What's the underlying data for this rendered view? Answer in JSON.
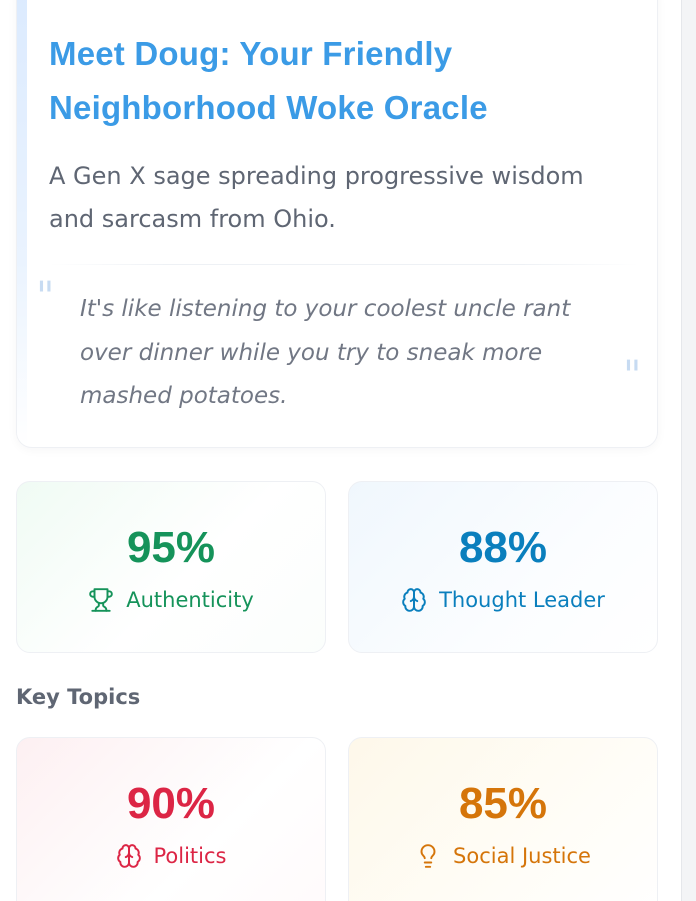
{
  "profile": {
    "title": "Meet Doug: Your Friendly Neighborhood Woke Oracle",
    "subtitle": "A Gen X sage spreading progressive wisdom and sarcasm from Ohio.",
    "quote": {
      "open_mark": "\"",
      "text": "It's like listening to your coolest uncle rant over dinner while you try to sneak more mashed potatoes.",
      "close_mark": "\""
    }
  },
  "stats": [
    {
      "value": "95%",
      "percent": 95,
      "label": "Authenticity",
      "icon": "trophy-icon",
      "color": "#15935a"
    },
    {
      "value": "88%",
      "percent": 88,
      "label": "Thought Leader",
      "icon": "brain-icon",
      "color": "#0a7fbd"
    }
  ],
  "key_topics": {
    "heading": "Key Topics",
    "items": [
      {
        "value": "90%",
        "percent": 90,
        "label": "Politics",
        "icon": "brain-icon",
        "color": "#dc2545"
      },
      {
        "value": "85%",
        "percent": 85,
        "label": "Social Justice",
        "icon": "lightbulb-icon",
        "color": "#d5750a"
      }
    ]
  },
  "colors": {
    "title_blue": "#3b9be6",
    "body_gray": "#5f6673",
    "quote_gray": "#717784"
  }
}
